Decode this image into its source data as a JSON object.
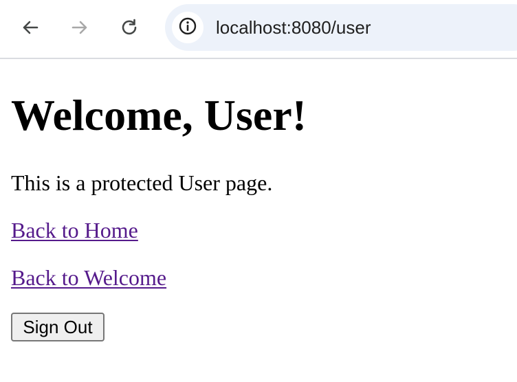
{
  "browser": {
    "url": "localhost:8080/user",
    "icons": {
      "back": "arrow-left-icon",
      "forward": "arrow-right-icon",
      "reload": "reload-icon",
      "site_info": "info-icon"
    }
  },
  "page": {
    "heading": "Welcome, User!",
    "intro": "This is a protected User page.",
    "links": [
      {
        "label": "Back to Home"
      },
      {
        "label": "Back to Welcome"
      }
    ],
    "sign_out_label": "Sign Out",
    "link_color": "#551a8b"
  }
}
